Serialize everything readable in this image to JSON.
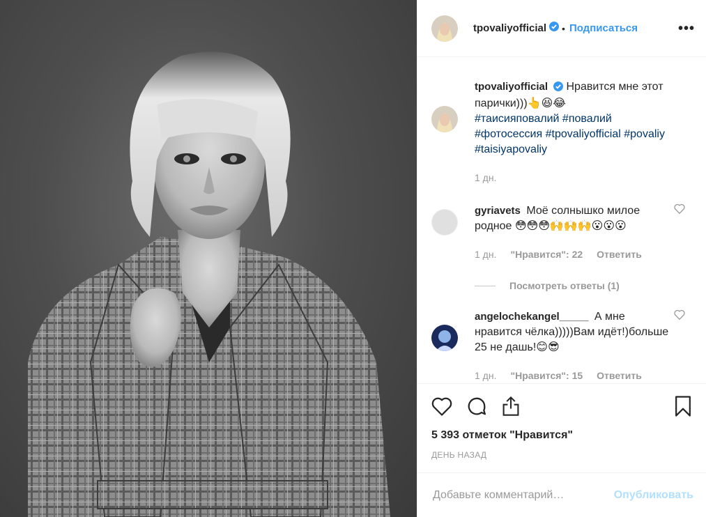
{
  "colors": {
    "link": "#3897f0",
    "hashtag": "#003569",
    "muted": "#999999",
    "verified": "#3897f0"
  },
  "photo": {
    "description_icon": "portrait-photo"
  },
  "header": {
    "username": "tpovaliyofficial",
    "dot": "•",
    "follow_label": "Подписаться",
    "more_label": "•••"
  },
  "caption": {
    "username": "tpovaliyofficial",
    "text": "Нравится мне этот парички)))👆😆😂",
    "tags": "#таисияповалий #повалий #фотосессия #tpovaliyofficial #povaliy #taisiyapovaliy",
    "time": "1 дн."
  },
  "comments": [
    {
      "username": "gyriavets",
      "text": "Моё солнышко милое родное 😳😳😳🙌🙌🙌😮😮😮",
      "time": "1 дн.",
      "likes": "\"Нравится\": 22",
      "reply": "Ответить",
      "view_replies": "Посмотреть ответы (1)"
    },
    {
      "username": "angelochekangel_____",
      "text": "А мне нравится чёлка)))))Вам идёт!)больше 25 не дашь!😊😎",
      "time": "1 дн.",
      "likes": "\"Нравится\": 15",
      "reply": "Ответить"
    }
  ],
  "likes_count": "5 393 отметок \"Нравится\"",
  "date": "ДЕНЬ НАЗАД",
  "add_comment": {
    "placeholder": "Добавьте комментарий…",
    "post_label": "Опубликовать"
  }
}
